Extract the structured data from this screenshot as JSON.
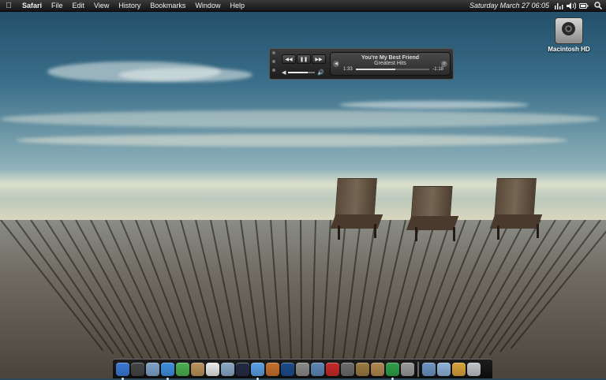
{
  "menubar": {
    "apple_icon": "apple-icon",
    "items": [
      "Safari",
      "File",
      "Edit",
      "View",
      "History",
      "Bookmarks",
      "Window",
      "Help"
    ],
    "datetime": "Saturday  March 27  06:05",
    "status_icons": [
      "activity-graph-icon",
      "volume-icon",
      "battery-icon",
      "spotlight-search-icon"
    ]
  },
  "desktop": {
    "drive_label": "Macintosh HD"
  },
  "player": {
    "song_title": "You're My Best Friend",
    "album": "Greatest Hits",
    "elapsed": "1:33",
    "remaining": "-1:18",
    "progress_fraction": 0.54,
    "volume_fraction": 0.72
  },
  "dock": {
    "icons": [
      {
        "name": "finder-icon",
        "color": "#3a78d4",
        "running": true
      },
      {
        "name": "dashboard-icon",
        "color": "#444444",
        "running": false
      },
      {
        "name": "mail-icon",
        "color": "#7fa3c8",
        "running": false
      },
      {
        "name": "safari-icon",
        "color": "#3d8fe0",
        "running": true
      },
      {
        "name": "ichat-icon",
        "color": "#4caf50",
        "running": false
      },
      {
        "name": "address-book-icon",
        "color": "#b9925a",
        "running": false
      },
      {
        "name": "ical-icon",
        "color": "#e9e9e9",
        "running": false
      },
      {
        "name": "iphoto-icon",
        "color": "#8aa8c6",
        "running": false
      },
      {
        "name": "itunes-icon",
        "color": "#222a44",
        "running": false
      },
      {
        "name": "quicktime-icon",
        "color": "#5aa0e6",
        "running": true
      },
      {
        "name": "keynote-icon",
        "color": "#c7702c",
        "running": false
      },
      {
        "name": "photoshop-icon",
        "color": "#1b4a8a",
        "running": false
      },
      {
        "name": "script-editor-icon",
        "color": "#8a8a8a",
        "running": false
      },
      {
        "name": "preview-icon",
        "color": "#5e86b4",
        "running": false
      },
      {
        "name": "flashcards-icon",
        "color": "#c62828",
        "running": false
      },
      {
        "name": "utility-icon",
        "color": "#6b6b6b",
        "running": false
      },
      {
        "name": "tools-icon",
        "color": "#9a7a40",
        "running": false
      },
      {
        "name": "brush-icon",
        "color": "#b08850",
        "running": false
      },
      {
        "name": "camino-icon",
        "color": "#2e9f4a",
        "running": true
      },
      {
        "name": "system-preferences-icon",
        "color": "#9a9a9a",
        "running": false
      },
      {
        "name": "applications-folder-icon",
        "color": "#6e94c2",
        "running": false
      },
      {
        "name": "documents-folder-icon",
        "color": "#8fb3d8",
        "running": false
      },
      {
        "name": "downloads-stack-icon",
        "color": "#d9a23a",
        "running": false
      },
      {
        "name": "trash-icon",
        "color": "#bfc4c8",
        "running": false
      }
    ]
  }
}
